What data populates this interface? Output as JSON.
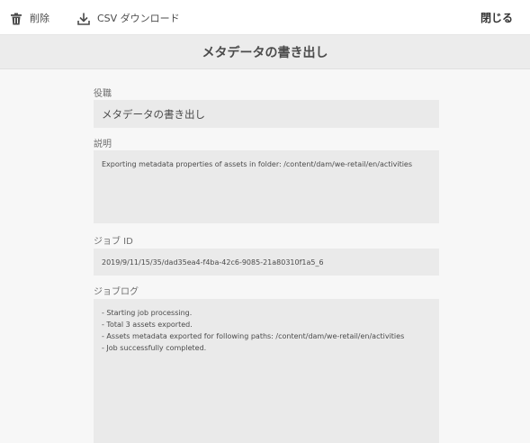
{
  "toolbar": {
    "delete_label": "削除",
    "csv_label": "CSV ダウンロード",
    "close_label": "閉じる",
    "delete_icon": "trash-icon",
    "csv_icon": "download-icon"
  },
  "header": {
    "title": "メタデータの書き出し"
  },
  "form": {
    "title_label": "役職",
    "title_value": "メタデータの書き出し",
    "description_label": "説明",
    "description_value": "Exporting metadata properties of assets in folder: /content/dam/we-retail/en/activities",
    "job_id_label": "ジョブ ID",
    "job_id_value": "2019/9/11/15/35/dad35ea4-f4ba-42c6-9085-21a80310f1a5_6",
    "job_log_label": "ジョブログ",
    "job_log_lines": [
      "- Starting job processing.",
      "- Total 3 assets exported.",
      "- Assets metadata exported for following paths: /content/dam/we-retail/en/activities",
      "- Job successfully completed."
    ]
  },
  "colors": {
    "page_background": "#f7f7f7",
    "toolbar_background": "#ffffff",
    "title_bar_background": "#ececec",
    "field_background": "#eaeaea",
    "text": "#4b4b4b"
  }
}
